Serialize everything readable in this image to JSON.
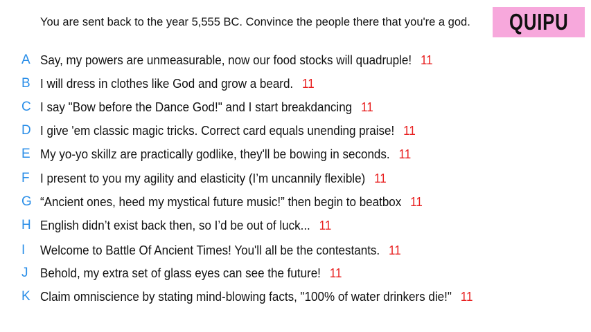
{
  "prompt": "You are sent back to the year 5,555 BC. Convince the people there that you're a god.",
  "brand": "QUIPU",
  "colors": {
    "letter": "#2a8ee8",
    "score": "#e81f1f",
    "brand_bg": "#f7a8dc"
  },
  "options": [
    {
      "letter": "A",
      "text": "Say, my powers are unmeasurable, now our food stocks will quadruple!",
      "score": "11"
    },
    {
      "letter": "B",
      "text": "I will dress in clothes like God and grow a beard.",
      "score": "11"
    },
    {
      "letter": "C",
      "text": "I say \"Bow before the Dance God!\" and I start breakdancing",
      "score": "11"
    },
    {
      "letter": "D",
      "text": "I give 'em classic magic tricks. Correct card equals unending praise!",
      "score": "11"
    },
    {
      "letter": "E",
      "text": "My yo-yo skillz are practically godlike, they'll be bowing in seconds.",
      "score": "11"
    },
    {
      "letter": "F",
      "text": "I present to you my agility and elasticity (I’m uncannily flexible)",
      "score": "11"
    },
    {
      "letter": "G",
      "text": "“Ancient ones, heed my mystical future music!” then begin to beatbox",
      "score": "11"
    },
    {
      "letter": "H",
      "text": "English didn’t exist back then, so I’d be out of luck...",
      "score": "11"
    },
    {
      "letter": "I",
      "text": "Welcome to Battle Of Ancient Times! You'll all be the contestants.",
      "score": "11"
    },
    {
      "letter": "J",
      "text": "Behold, my extra set of glass eyes can see the future!",
      "score": "11"
    },
    {
      "letter": "K",
      "text": "Claim omniscience by stating mind-blowing facts, \"100% of water drinkers die!\"",
      "score": "11"
    }
  ]
}
